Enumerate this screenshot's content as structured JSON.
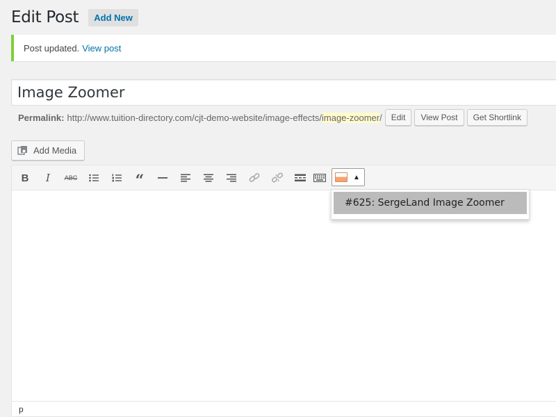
{
  "header": {
    "title": "Edit Post",
    "add_new_label": "Add New"
  },
  "notice": {
    "message": "Post updated.",
    "link_label": "View post",
    "accent_color": "#7ad03a"
  },
  "post": {
    "title": "Image Zoomer"
  },
  "permalink": {
    "label": "Permalink:",
    "base_url": "http://www.tuition-directory.com/cjt-demo-website/image-effects/",
    "slug": "image-zoomer",
    "trailing": "/",
    "edit_label": "Edit",
    "view_post_label": "View Post",
    "shortlink_label": "Get Shortlink"
  },
  "media": {
    "add_media_label": "Add Media"
  },
  "toolbar": {
    "buttons": [
      "bold-icon",
      "italic-icon",
      "strikethrough-icon",
      "bullet-list-icon",
      "numbered-list-icon",
      "blockquote-icon",
      "horizontal-line-icon",
      "align-left-icon",
      "align-center-icon",
      "align-right-icon",
      "insert-link-icon",
      "remove-link-icon",
      "read-more-icon",
      "toolbar-toggle-icon",
      "shortcode-image-icon"
    ],
    "dropdown_arrow": "▲"
  },
  "dropdown": {
    "items": [
      "#625: SergeLand Image Zoomer"
    ]
  },
  "statusbar": {
    "path": "p"
  }
}
